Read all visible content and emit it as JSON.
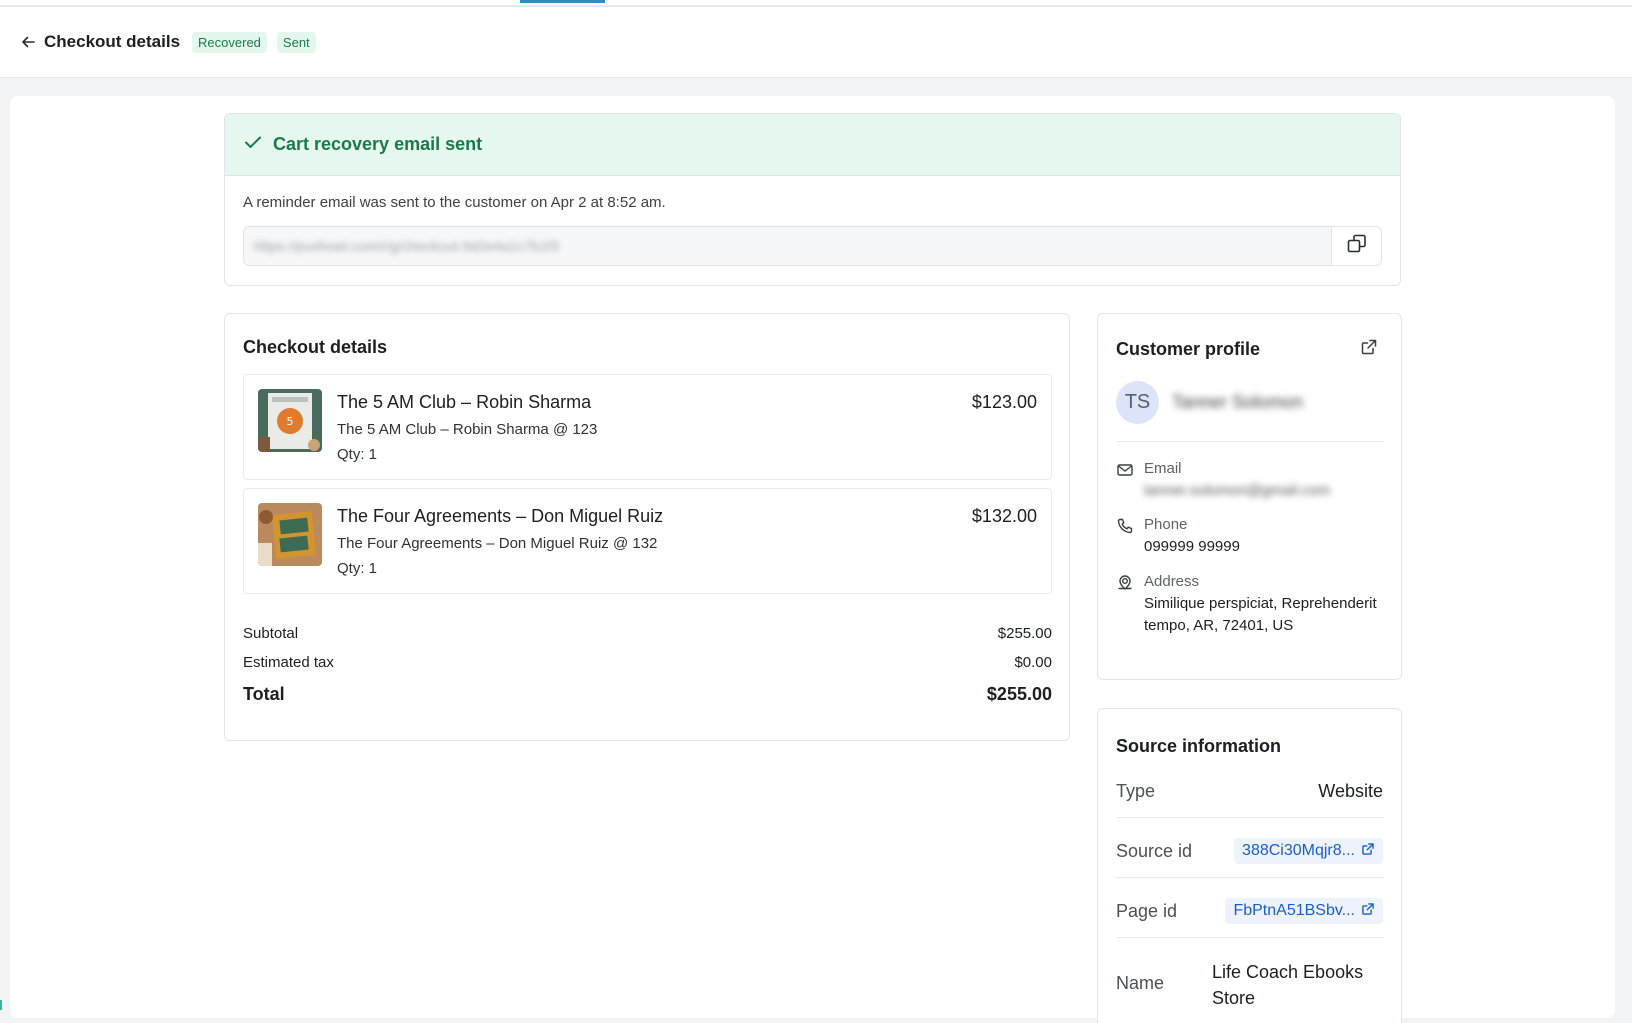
{
  "header": {
    "title": "Checkout details",
    "badges": [
      "Recovered",
      "Sent"
    ]
  },
  "recovery": {
    "title": "Cart recovery email sent",
    "message": "A reminder email was sent to the customer on Apr 2 at 8:52 am.",
    "link": "https://pushowl.com/r/g/checkout-9d2e4a1c7b1f3"
  },
  "checkout": {
    "title": "Checkout details",
    "items": [
      {
        "name": "The 5 AM Club – Robin Sharma",
        "variant": "The 5 AM Club – Robin Sharma @ 123",
        "qty": "Qty: 1",
        "price": "$123.00"
      },
      {
        "name": "The Four Agreements – Don Miguel Ruiz",
        "variant": "The Four Agreements – Don Miguel Ruiz @ 132",
        "qty": "Qty: 1",
        "price": "$132.00"
      }
    ],
    "summary": {
      "subtotal_label": "Subtotal",
      "subtotal": "$255.00",
      "tax_label": "Estimated tax",
      "tax": "$0.00",
      "total_label": "Total",
      "total": "$255.00"
    }
  },
  "profile": {
    "title": "Customer profile",
    "initials": "TS",
    "name": "Tanner Solomon",
    "email_label": "Email",
    "email": "tanner.solomon@gmail.com",
    "phone_label": "Phone",
    "phone": "099999 99999",
    "address_label": "Address",
    "address": "Similique perspiciat, Reprehenderit tempo, AR, 72401, US"
  },
  "source": {
    "title": "Source information",
    "type_label": "Type",
    "type": "Website",
    "source_id_label": "Source id",
    "source_id": "388Ci30Mqjr8...",
    "page_id_label": "Page id",
    "page_id": "FbPtnA51BSbv...",
    "name_label": "Name",
    "name": "Life Coach Ebooks Store"
  },
  "colors": {
    "success_bg": "#e6f8ee",
    "success_text": "#1a7a4b",
    "link_blue": "#1a5fc7",
    "tab_accent": "#2b8fc2"
  },
  "icons": [
    "back-arrow-icon",
    "check-icon",
    "copy-icon",
    "external-link-icon",
    "mail-icon",
    "phone-icon",
    "location-icon"
  ]
}
